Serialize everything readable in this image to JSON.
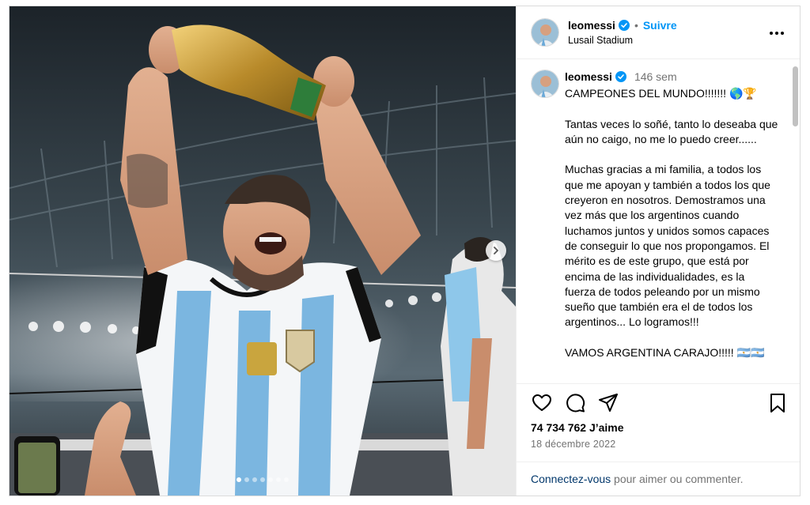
{
  "post": {
    "username": "leomessi",
    "follow_label": "Suivre",
    "separator": "•",
    "location": "Lusail Stadium",
    "caption": {
      "time_ago": "146 sem",
      "text": "CAMPEONES DEL MUNDO!!!!!!! 🌎🏆\n\nTantas veces lo soñé, tanto lo deseaba que aún no caigo, no me lo puedo creer......\n\nMuchas gracias a mi familia, a todos los que me apoyan y también a todos los que creyeron en nosotros. Demostramos una vez más que los argentinos cuando luchamos juntos y unidos somos capaces de conseguir lo que nos propongamos. El mérito es de este grupo, que está por encima de las individualidades, es la fuerza de todos peleando por un mismo sueño que también era el de todos los argentinos... Lo logramos!!!\n\nVAMOS ARGENTINA CARAJO!!!!! 🇦🇷🇦🇷"
    },
    "likes": "74 734 762 J’aime",
    "date": "18 décembre 2022",
    "login_prompt": {
      "link": "Connectez-vous",
      "rest": " pour aimer ou commenter."
    },
    "carousel": {
      "slides": 7,
      "active_index": 0
    }
  },
  "icons": {
    "verified": "verified-badge-icon",
    "more": "more-options-icon",
    "like": "heart-icon",
    "comment": "comment-icon",
    "share": "send-icon",
    "save": "bookmark-icon",
    "next": "chevron-right-icon"
  },
  "colors": {
    "link_blue": "#0095f6",
    "dark_link": "#00376b",
    "muted": "#737373",
    "border": "#dbdbdb"
  }
}
